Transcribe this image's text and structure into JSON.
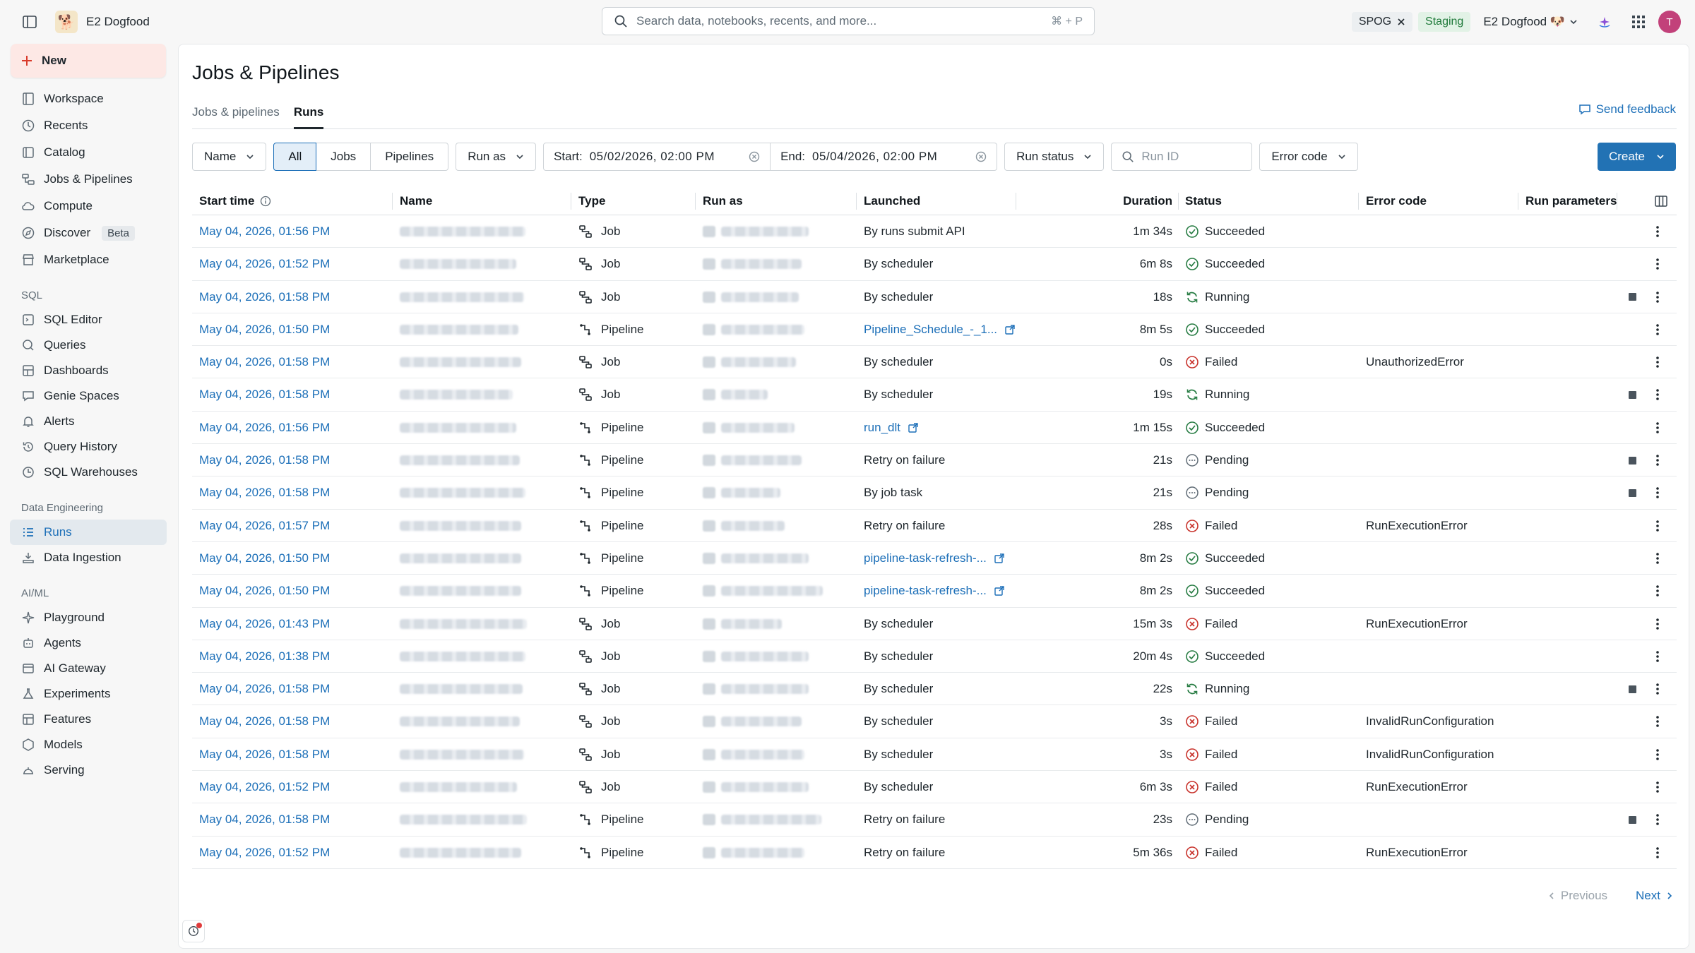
{
  "header": {
    "workspace_name": "E2 Dogfood",
    "search_placeholder": "Search data, notebooks, recents, and more...",
    "search_shortcut": "⌘ + P",
    "spog_chip": "SPOG",
    "env_chip": "Staging",
    "workspace_switcher": "E2 Dogfood 🐶",
    "avatar_initial": "T"
  },
  "sidebar": {
    "new_label": "New",
    "items": [
      {
        "label": "Workspace",
        "icon": "folder-icon"
      },
      {
        "label": "Recents",
        "icon": "clock-icon"
      },
      {
        "label": "Catalog",
        "icon": "catalog-icon"
      },
      {
        "label": "Jobs & Pipelines",
        "icon": "workflow-icon"
      },
      {
        "label": "Compute",
        "icon": "cloud-icon"
      },
      {
        "label": "Discover",
        "icon": "compass-icon",
        "badge": "Beta"
      },
      {
        "label": "Marketplace",
        "icon": "store-icon"
      }
    ],
    "sql_section": "SQL",
    "sql_items": [
      {
        "label": "SQL Editor"
      },
      {
        "label": "Queries"
      },
      {
        "label": "Dashboards"
      },
      {
        "label": "Genie Spaces"
      },
      {
        "label": "Alerts"
      },
      {
        "label": "Query History"
      },
      {
        "label": "SQL Warehouses"
      }
    ],
    "de_section": "Data Engineering",
    "de_items": [
      {
        "label": "Runs"
      },
      {
        "label": "Data Ingestion"
      }
    ],
    "ai_section": "AI/ML",
    "ai_items": [
      {
        "label": "Playground"
      },
      {
        "label": "Agents"
      },
      {
        "label": "AI Gateway"
      },
      {
        "label": "Experiments"
      },
      {
        "label": "Features"
      },
      {
        "label": "Models"
      },
      {
        "label": "Serving"
      }
    ]
  },
  "page": {
    "title": "Jobs & Pipelines",
    "tabs": [
      "Jobs & pipelines",
      "Runs"
    ],
    "send_feedback": "Send feedback"
  },
  "filters": {
    "name": "Name",
    "seg": [
      "All",
      "Jobs",
      "Pipelines"
    ],
    "run_as": "Run as",
    "start_label": "Start:",
    "start_value": "05/02/2026, 02:00 PM",
    "end_label": "End:",
    "end_value": "05/04/2026, 02:00 PM",
    "run_status": "Run status",
    "run_id_placeholder": "Run ID",
    "error_code": "Error code",
    "create": "Create"
  },
  "table": {
    "columns": [
      "Start time",
      "Name",
      "Type",
      "Run as",
      "Launched",
      "Duration",
      "Status",
      "Error code",
      "Run parameters"
    ],
    "rows": [
      {
        "start": "May 04, 2026, 01:56 PM",
        "type": "Job",
        "launched": "By runs submit API",
        "launched_link": false,
        "duration": "1m 34s",
        "status": "Succeeded",
        "error": "",
        "stop": false
      },
      {
        "start": "May 04, 2026, 01:52 PM",
        "type": "Job",
        "launched": "By scheduler",
        "launched_link": false,
        "duration": "6m 8s",
        "status": "Succeeded",
        "error": "",
        "stop": false
      },
      {
        "start": "May 04, 2026, 01:58 PM",
        "type": "Job",
        "launched": "By scheduler",
        "launched_link": false,
        "duration": "18s",
        "status": "Running",
        "error": "",
        "stop": true
      },
      {
        "start": "May 04, 2026, 01:50 PM",
        "type": "Pipeline",
        "launched": "Pipeline_Schedule_-_1...",
        "launched_link": true,
        "duration": "8m 5s",
        "status": "Succeeded",
        "error": "",
        "stop": false
      },
      {
        "start": "May 04, 2026, 01:58 PM",
        "type": "Job",
        "launched": "By scheduler",
        "launched_link": false,
        "duration": "0s",
        "status": "Failed",
        "error": "UnauthorizedError",
        "stop": false
      },
      {
        "start": "May 04, 2026, 01:58 PM",
        "type": "Job",
        "launched": "By scheduler",
        "launched_link": false,
        "duration": "19s",
        "status": "Running",
        "error": "",
        "stop": true
      },
      {
        "start": "May 04, 2026, 01:56 PM",
        "type": "Pipeline",
        "launched": "run_dlt",
        "launched_link": true,
        "duration": "1m 15s",
        "status": "Succeeded",
        "error": "",
        "stop": false
      },
      {
        "start": "May 04, 2026, 01:58 PM",
        "type": "Pipeline",
        "launched": "Retry on failure",
        "launched_link": false,
        "duration": "21s",
        "status": "Pending",
        "error": "",
        "stop": true
      },
      {
        "start": "May 04, 2026, 01:58 PM",
        "type": "Pipeline",
        "launched": "By job task",
        "launched_link": false,
        "duration": "21s",
        "status": "Pending",
        "error": "",
        "stop": true
      },
      {
        "start": "May 04, 2026, 01:57 PM",
        "type": "Pipeline",
        "launched": "Retry on failure",
        "launched_link": false,
        "duration": "28s",
        "status": "Failed",
        "error": "RunExecutionError",
        "stop": false
      },
      {
        "start": "May 04, 2026, 01:50 PM",
        "type": "Pipeline",
        "launched": "pipeline-task-refresh-...",
        "launched_link": true,
        "duration": "8m 2s",
        "status": "Succeeded",
        "error": "",
        "stop": false
      },
      {
        "start": "May 04, 2026, 01:50 PM",
        "type": "Pipeline",
        "launched": "pipeline-task-refresh-...",
        "launched_link": true,
        "duration": "8m 2s",
        "status": "Succeeded",
        "error": "",
        "stop": false
      },
      {
        "start": "May 04, 2026, 01:43 PM",
        "type": "Job",
        "launched": "By scheduler",
        "launched_link": false,
        "duration": "15m 3s",
        "status": "Failed",
        "error": "RunExecutionError",
        "stop": false
      },
      {
        "start": "May 04, 2026, 01:38 PM",
        "type": "Job",
        "launched": "By scheduler",
        "launched_link": false,
        "duration": "20m 4s",
        "status": "Succeeded",
        "error": "",
        "stop": false
      },
      {
        "start": "May 04, 2026, 01:58 PM",
        "type": "Job",
        "launched": "By scheduler",
        "launched_link": false,
        "duration": "22s",
        "status": "Running",
        "error": "",
        "stop": true
      },
      {
        "start": "May 04, 2026, 01:58 PM",
        "type": "Job",
        "launched": "By scheduler",
        "launched_link": false,
        "duration": "3s",
        "status": "Failed",
        "error": "InvalidRunConfiguration",
        "stop": false
      },
      {
        "start": "May 04, 2026, 01:58 PM",
        "type": "Job",
        "launched": "By scheduler",
        "launched_link": false,
        "duration": "3s",
        "status": "Failed",
        "error": "InvalidRunConfiguration",
        "stop": false
      },
      {
        "start": "May 04, 2026, 01:52 PM",
        "type": "Job",
        "launched": "By scheduler",
        "launched_link": false,
        "duration": "6m 3s",
        "status": "Failed",
        "error": "RunExecutionError",
        "stop": false
      },
      {
        "start": "May 04, 2026, 01:58 PM",
        "type": "Pipeline",
        "launched": "Retry on failure",
        "launched_link": false,
        "duration": "23s",
        "status": "Pending",
        "error": "",
        "stop": true
      },
      {
        "start": "May 04, 2026, 01:52 PM",
        "type": "Pipeline",
        "launched": "Retry on failure",
        "launched_link": false,
        "duration": "5m 36s",
        "status": "Failed",
        "error": "RunExecutionError",
        "stop": false
      }
    ]
  },
  "pager": {
    "previous": "Previous",
    "next": "Next"
  },
  "colors": {
    "accent": "#2272b4",
    "success": "#277c43",
    "failed": "#c8322b",
    "pending": "#5f6b75"
  }
}
